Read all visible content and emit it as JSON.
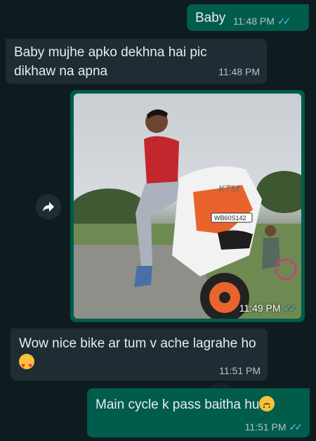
{
  "messages": [
    {
      "id": "m1",
      "text": "Baby",
      "time": "11:48 PM",
      "ticks": "✓✓"
    },
    {
      "id": "m2",
      "text": "Baby mujhe apko dekhna hai pic dikhaw na apna",
      "time": "11:48 PM"
    },
    {
      "id": "m3",
      "type": "image",
      "time": "11:49 PM",
      "ticks": "✓✓",
      "plate": "WB60S142",
      "bike_brand": "KTM"
    },
    {
      "id": "m4",
      "text": "Wow nice bike ar tum v ache lagrahe ho",
      "time": "11:51 PM"
    },
    {
      "id": "m5",
      "text": "Main cycle k pass baitha hu",
      "time": "11:51 PM",
      "ticks": "✓✓"
    }
  ],
  "colors": {
    "outgoing_bubble": "#005c4b",
    "incoming_bubble": "#1f2c33",
    "read_ticks": "#53bdeb",
    "background": "#0e1b1f"
  },
  "icons": {
    "forward": "forward-arrow-icon",
    "emoji_love": "smiling-face-with-hearts-emoji",
    "emoji_sad": "frowning-face-emoji"
  }
}
